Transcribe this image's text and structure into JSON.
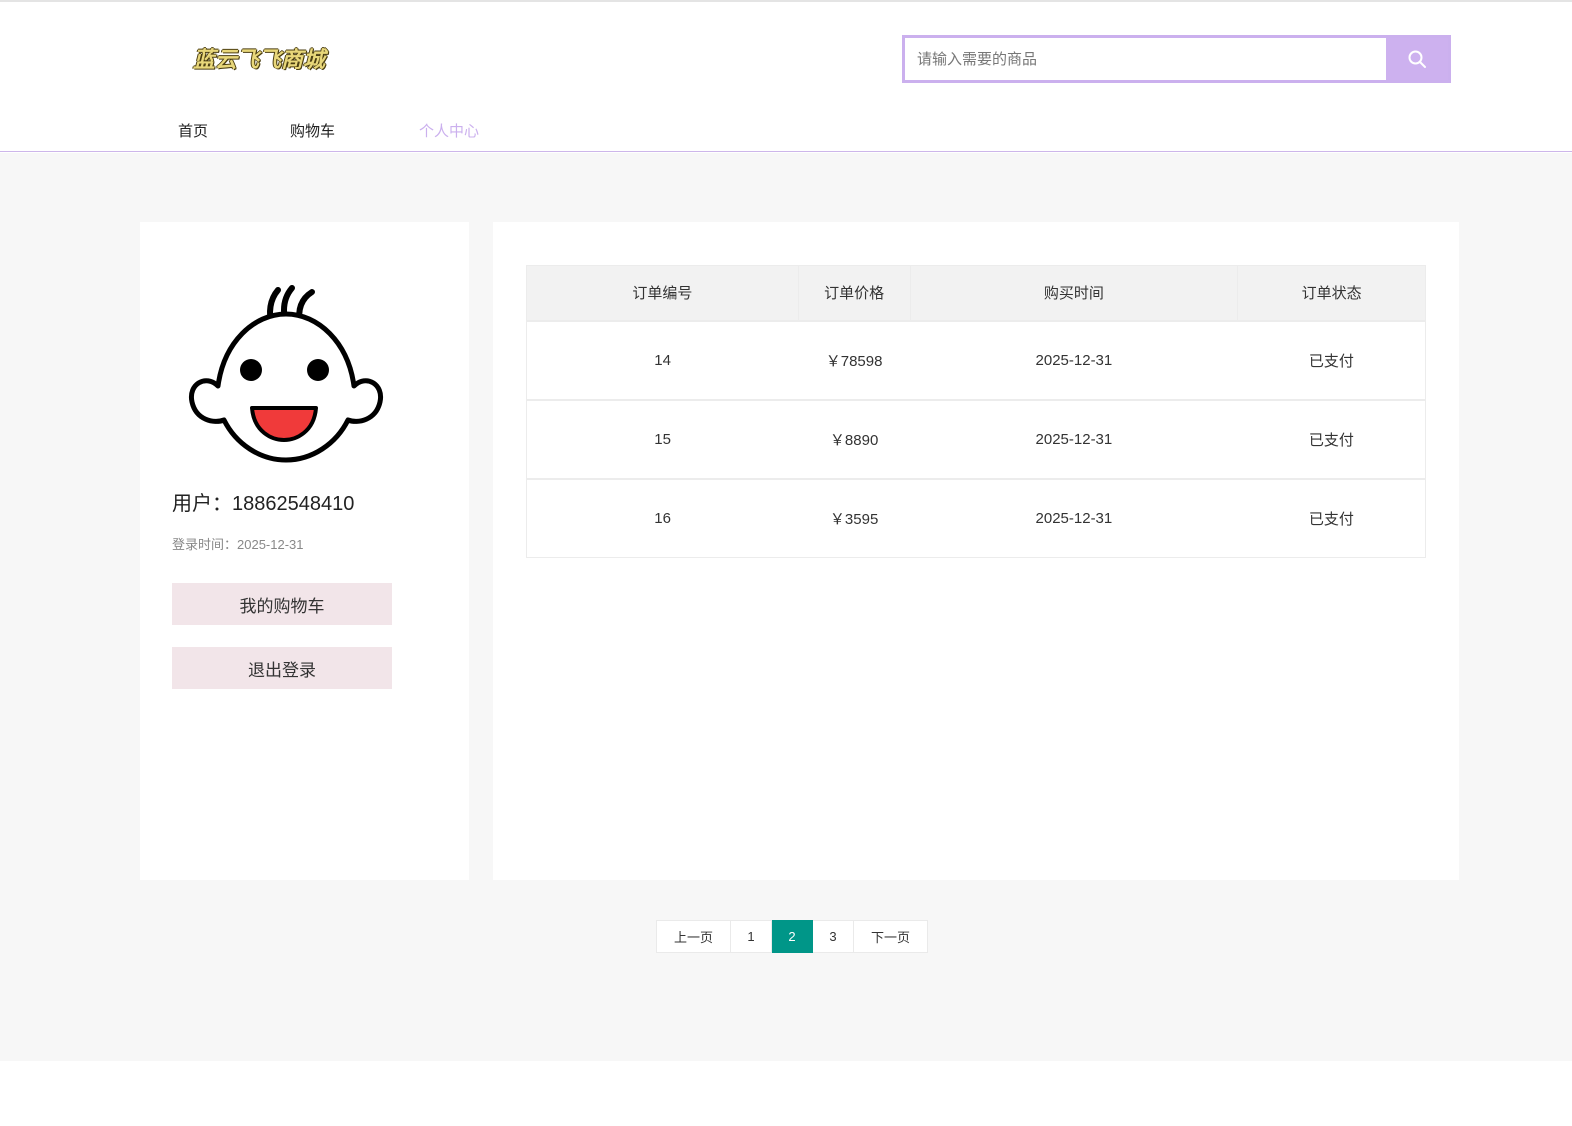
{
  "header": {
    "logo_text": "蓝云飞飞商城",
    "search": {
      "placeholder": "请输入需要的商品",
      "value": ""
    },
    "search_button_icon": "search-icon"
  },
  "nav": {
    "items": [
      {
        "label": "首页",
        "active": false
      },
      {
        "label": "购物车",
        "active": false
      },
      {
        "label": "个人中心",
        "active": true
      }
    ]
  },
  "profile": {
    "avatar_icon": "baby-face-icon",
    "user_label": "用户：",
    "user_value": "18862548410",
    "login_label": "登录时间：",
    "login_value": "2025-12-31",
    "cart_button": "我的购物车",
    "logout_button": "退出登录"
  },
  "orders": {
    "columns": [
      "订单编号",
      "订单价格",
      "购买时间",
      "订单状态"
    ],
    "rows": [
      {
        "id": "14",
        "price": "￥78598",
        "time": "2025-12-31",
        "status": "已支付"
      },
      {
        "id": "15",
        "price": "￥8890",
        "time": "2025-12-31",
        "status": "已支付"
      },
      {
        "id": "16",
        "price": "￥3595",
        "time": "2025-12-31",
        "status": "已支付"
      }
    ]
  },
  "pagination": {
    "prev": "上一页",
    "pages": [
      "1",
      "2",
      "3"
    ],
    "current": "2",
    "next": "下一页"
  },
  "colors": {
    "accent": "#cdb1ef",
    "pager_active": "#009688",
    "button_bg": "#f2e5e9",
    "page_bg": "#f7f7f7"
  }
}
